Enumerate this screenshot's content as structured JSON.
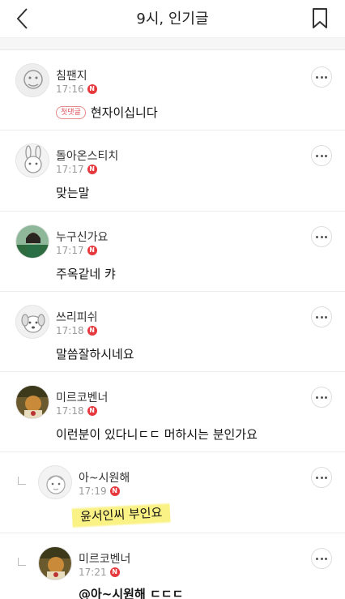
{
  "header": {
    "title": "9시, 인기글",
    "back_icon": "chevron-left-icon",
    "bookmark_icon": "bookmark-icon"
  },
  "new_badge": "N",
  "comments": [
    {
      "nickname": "침팬지",
      "time": "17:16",
      "tag": "첫댓글",
      "text": "현자이십니다",
      "reply": false
    },
    {
      "nickname": "돌아온스티치",
      "time": "17:17",
      "text": "맞는말",
      "reply": false
    },
    {
      "nickname": "누구신가요",
      "time": "17:17",
      "text": "주옥같네 캬",
      "reply": false
    },
    {
      "nickname": "쓰리피쉬",
      "time": "17:18",
      "text": "말씀잘하시네요",
      "reply": false
    },
    {
      "nickname": "미르코벤너",
      "time": "17:18",
      "text": "이런분이 있다니ㄷㄷ 머하시는 분인가요",
      "reply": false
    },
    {
      "nickname": "아~시원해",
      "time": "17:19",
      "text": "윤서인씨 부인요",
      "reply": true
    },
    {
      "nickname": "미르코벤너",
      "time": "17:21",
      "text": "@아~시원해 ㄷㄷㄷ",
      "reply": true
    }
  ],
  "colors": {
    "badge": "#e5393e",
    "highlight": "#faf078",
    "tag_text": "#e0505a"
  }
}
